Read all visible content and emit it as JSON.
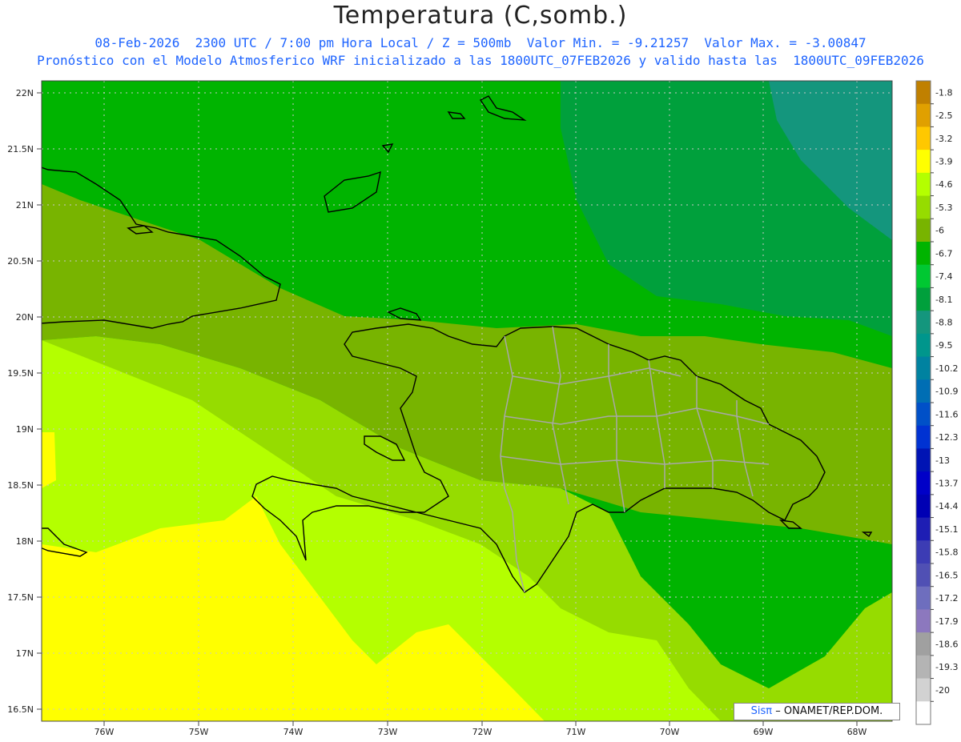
{
  "header": {
    "title": "Temperatura (C,somb.)",
    "subtitle_line1": "08-Feb-2026  2300 UTC / 7:00 pm Hora Local / Z = 500mb  Valor Min. = -9.21257  Valor Max. = -3.00847",
    "subtitle_line2": "Pronóstico con el Modelo Atmosferico WRF inicializado a las 1800UTC_07FEB2026 y valido hasta las  1800UTC_09FEB2026"
  },
  "axes": {
    "lat_labels": [
      "22N",
      "21.5N",
      "21N",
      "20.5N",
      "20N",
      "19.5N",
      "19N",
      "18.5N",
      "18N",
      "17.5N",
      "17N",
      "16.5N"
    ],
    "lon_labels": [
      "76W",
      "75W",
      "74W",
      "73W",
      "72W",
      "71W",
      "70W",
      "69W",
      "68W"
    ]
  },
  "colorbar": {
    "labels": [
      "-1.8",
      "-2.5",
      "-3.2",
      "-3.9",
      "-4.6",
      "-5.3",
      "-6",
      "-6.7",
      "-7.4",
      "-8.1",
      "-8.8",
      "-9.5",
      "-10.2",
      "-10.9",
      "-11.6",
      "-12.3",
      "-13",
      "-13.7",
      "-14.4",
      "-15.1",
      "-15.8",
      "-16.5",
      "-17.2",
      "-17.9",
      "-18.6",
      "-19.3",
      "-20"
    ],
    "colors": [
      "#c08000",
      "#e0a000",
      "#ffc800",
      "#ffff00",
      "#b4ff00",
      "#96dc00",
      "#78b400",
      "#00b400",
      "#00c832",
      "#00a03c",
      "#14967d",
      "#00968c",
      "#0082a0",
      "#006eb4",
      "#0050c8",
      "#0032d2",
      "#0014b4",
      "#0000c8",
      "#0000b4",
      "#1e1eb4",
      "#3c3cb4",
      "#5050b4",
      "#6e6ebe",
      "#8c78be",
      "#a0a0a0",
      "#b4b4b4",
      "#d2d2d2",
      "#ffffff"
    ]
  },
  "footer": {
    "logo": "Sisπ",
    "credit": "– ONAMET/REP.DOM."
  }
}
